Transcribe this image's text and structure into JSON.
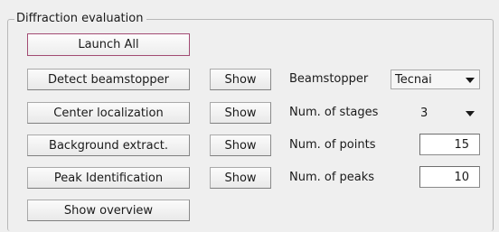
{
  "group": {
    "title": "Diffraction evaluation"
  },
  "buttons": {
    "launch_all": "Launch All",
    "detect_beamstopper": "Detect beamstopper",
    "center_localization": "Center localization",
    "background_extract": "Background extract.",
    "peak_identification": "Peak Identification",
    "show_overview": "Show overview",
    "show": "Show"
  },
  "params": {
    "beamstopper": {
      "label": "Beamstopper",
      "value": "Tecnai"
    },
    "num_stages": {
      "label": "Num. of stages",
      "value": "3"
    },
    "num_points": {
      "label": "Num. of points",
      "value": "15"
    },
    "num_peaks": {
      "label": "Num. of peaks",
      "value": "10"
    }
  },
  "icons": {
    "dropdown": "chevron-down-icon"
  }
}
